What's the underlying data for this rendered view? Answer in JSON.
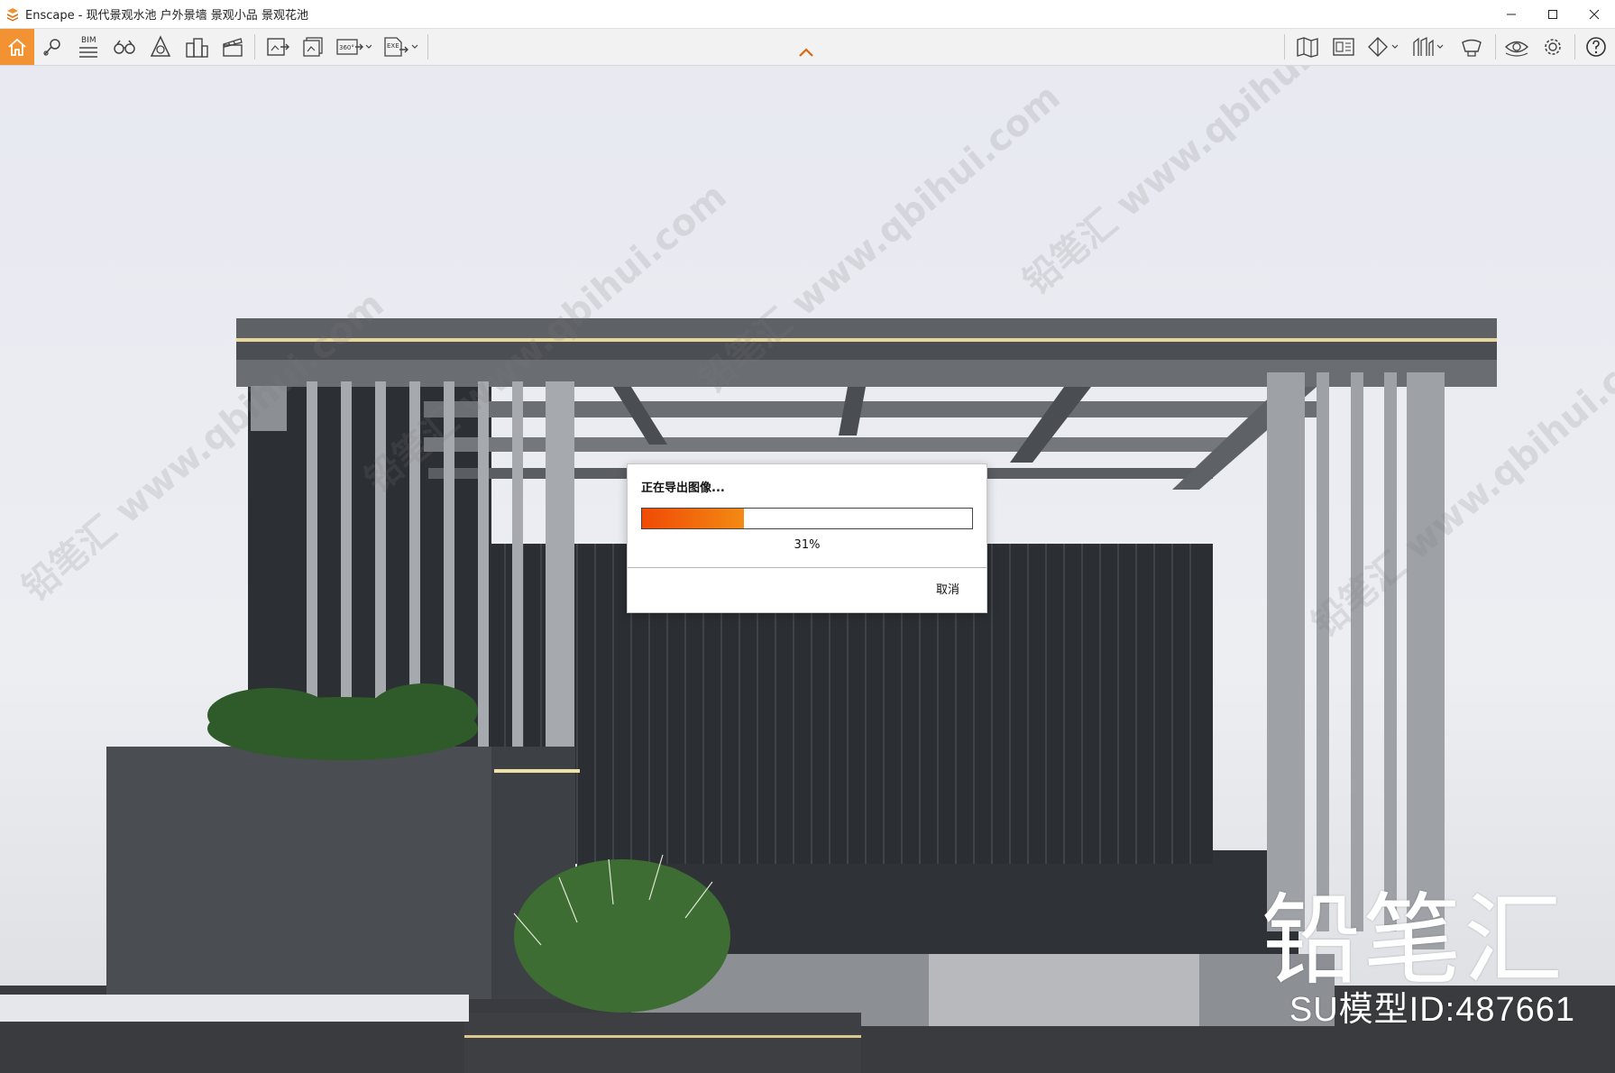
{
  "window": {
    "title": "Enscape - 现代景观水池 户外景墙 景观小品 景观花池",
    "controls": [
      "minimize-icon",
      "maximize-icon",
      "close-icon"
    ]
  },
  "toolbar": {
    "left_icons": [
      "home-icon",
      "location-pin-icon",
      "bim-icon",
      "binoculars-icon",
      "asset-library-icon",
      "buildings-icon",
      "clapper-icon",
      "screenshot-export-icon",
      "batch-export-icon",
      "export-360-icon",
      "export-exe-icon"
    ],
    "bim_label": "BIM",
    "badge_360": "360°",
    "badge_exe": "EXE",
    "right_icons": [
      "map-icon",
      "material-editor-icon",
      "section-icon",
      "walkthrough-icon",
      "feedback-icon",
      "eye-icon",
      "settings-icon",
      "help-icon"
    ],
    "accent": "#f39233"
  },
  "dialog": {
    "title": "正在导出图像...",
    "progress": 0.31,
    "percent_text": "31%",
    "cancel_label": "取消",
    "bar_color": "#f36a0c"
  },
  "watermark": {
    "brand": "铅笔汇",
    "model_id": "SU模型ID:487661",
    "diagonal_text": "铅笔汇 www.qbihui.com"
  }
}
